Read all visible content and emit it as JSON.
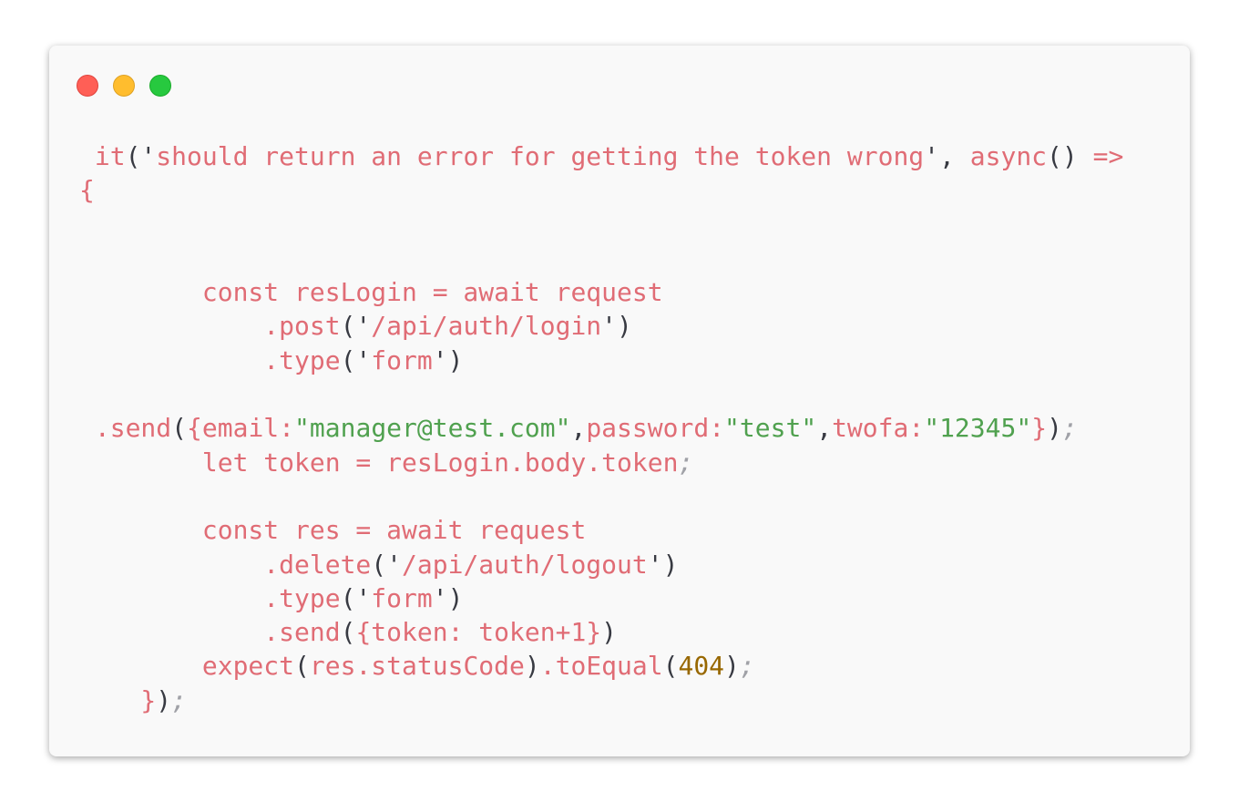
{
  "window": {
    "buttons": [
      {
        "name": "close",
        "color": "#ff5f56"
      },
      {
        "name": "minimize",
        "color": "#ffbd2e"
      },
      {
        "name": "zoom",
        "color": "#27c93f"
      }
    ]
  },
  "code_lines": [
    [
      {
        "t": " it",
        "c": "k"
      },
      {
        "t": "('",
        "c": "p"
      },
      {
        "t": "should return an error for getting the token wrong",
        "c": "k"
      },
      {
        "t": "', ",
        "c": "p"
      },
      {
        "t": "async",
        "c": "k"
      },
      {
        "t": "() ",
        "c": "p"
      },
      {
        "t": "=>",
        "c": "k"
      }
    ],
    [
      {
        "t": "{",
        "c": "k"
      }
    ],
    [],
    [],
    [
      {
        "t": "        const resLogin = await request",
        "c": "k"
      }
    ],
    [
      {
        "t": "            .post",
        "c": "k"
      },
      {
        "t": "('",
        "c": "p"
      },
      {
        "t": "/api/auth/login",
        "c": "k"
      },
      {
        "t": "')",
        "c": "p"
      }
    ],
    [
      {
        "t": "            .type",
        "c": "k"
      },
      {
        "t": "('",
        "c": "p"
      },
      {
        "t": "form",
        "c": "k"
      },
      {
        "t": "')",
        "c": "p"
      }
    ],
    [],
    [
      {
        "t": " .send",
        "c": "k"
      },
      {
        "t": "(",
        "c": "p"
      },
      {
        "t": "{email:",
        "c": "k"
      },
      {
        "t": "\"manager@test.com\"",
        "c": "s"
      },
      {
        "t": ",",
        "c": "p"
      },
      {
        "t": "password:",
        "c": "k"
      },
      {
        "t": "\"test\"",
        "c": "s"
      },
      {
        "t": ",",
        "c": "p"
      },
      {
        "t": "twofa:",
        "c": "k"
      },
      {
        "t": "\"12345\"",
        "c": "s"
      },
      {
        "t": "}",
        "c": "k"
      },
      {
        "t": ")",
        "c": "p"
      },
      {
        "t": ";",
        "c": "c"
      }
    ],
    [
      {
        "t": "        let token = resLogin.body.token",
        "c": "k"
      },
      {
        "t": ";",
        "c": "c"
      }
    ],
    [],
    [
      {
        "t": "        const res = await request",
        "c": "k"
      }
    ],
    [
      {
        "t": "            .delete",
        "c": "k"
      },
      {
        "t": "('",
        "c": "p"
      },
      {
        "t": "/api/auth/logout",
        "c": "k"
      },
      {
        "t": "')",
        "c": "p"
      }
    ],
    [
      {
        "t": "            .type",
        "c": "k"
      },
      {
        "t": "('",
        "c": "p"
      },
      {
        "t": "form",
        "c": "k"
      },
      {
        "t": "')",
        "c": "p"
      }
    ],
    [
      {
        "t": "            .send",
        "c": "k"
      },
      {
        "t": "(",
        "c": "p"
      },
      {
        "t": "{token: token+1}",
        "c": "k"
      },
      {
        "t": ")",
        "c": "p"
      }
    ],
    [
      {
        "t": "        expect",
        "c": "k"
      },
      {
        "t": "(",
        "c": "p"
      },
      {
        "t": "res.statusCode",
        "c": "k"
      },
      {
        "t": ")",
        "c": "p"
      },
      {
        "t": ".toEqual",
        "c": "k"
      },
      {
        "t": "(",
        "c": "p"
      },
      {
        "t": "404",
        "c": "n"
      },
      {
        "t": ")",
        "c": "p"
      },
      {
        "t": ";",
        "c": "c"
      }
    ],
    [
      {
        "t": "    }",
        "c": "k"
      },
      {
        "t": ")",
        "c": "p"
      },
      {
        "t": ";",
        "c": "c"
      }
    ]
  ]
}
